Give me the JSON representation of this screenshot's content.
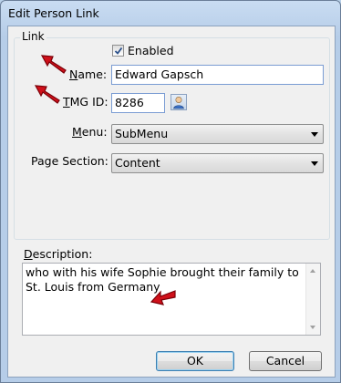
{
  "window": {
    "title": "Edit Person Link"
  },
  "link_group": {
    "legend": "Link",
    "enabled": {
      "label": "Enabled",
      "checked": true
    },
    "name": {
      "label_u": "N",
      "label_rest": "ame:",
      "value": "Edward Gapsch"
    },
    "tmg_id": {
      "label_u": "T",
      "label_rest": "MG ID:",
      "value": "8286"
    },
    "menu": {
      "label_prefix": "",
      "label_u": "M",
      "label_rest": "enu:",
      "value": "SubMenu"
    },
    "page_section": {
      "label": "Page Section:",
      "value": "Content"
    }
  },
  "description": {
    "label_u": "D",
    "label_rest": "escription:",
    "value": "who with his wife Sophie brought their family to St. Louis from Germany"
  },
  "buttons": {
    "ok": "OK",
    "cancel": "Cancel"
  },
  "colors": {
    "arrow_red": "#d0101a"
  }
}
